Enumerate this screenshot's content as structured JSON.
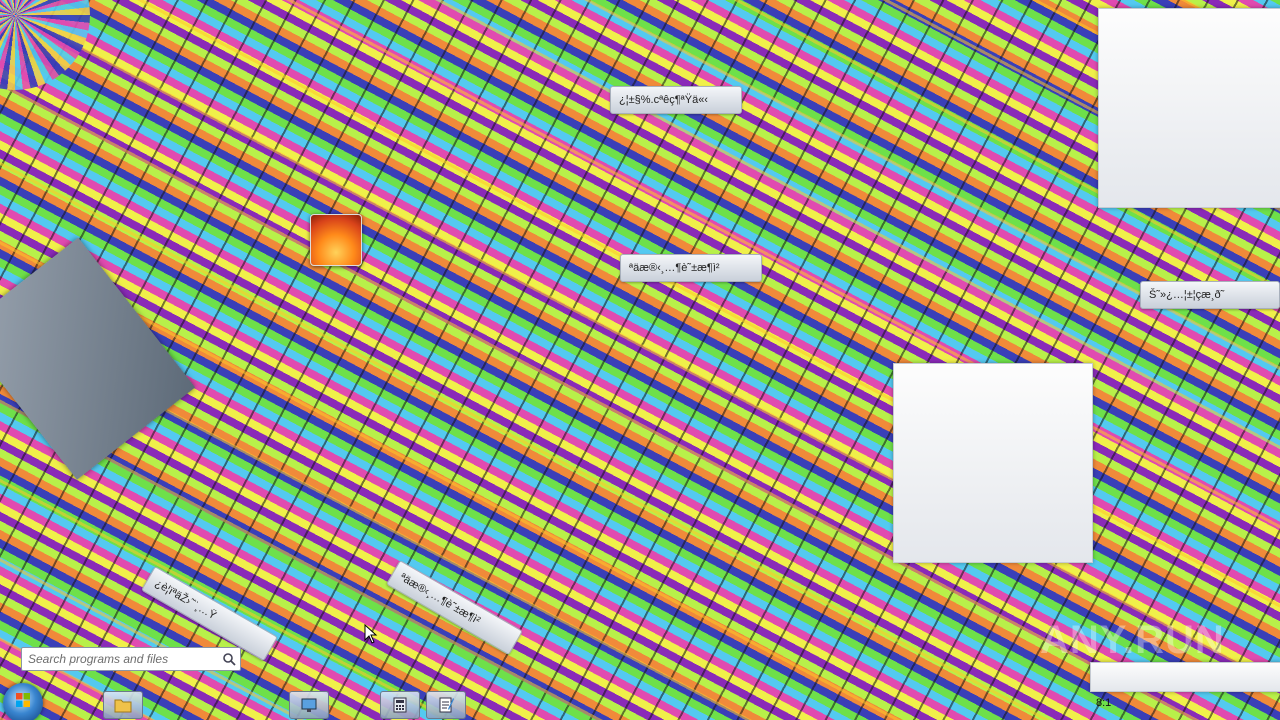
{
  "desktop": {
    "icon_names": {
      "desktop_image_icon": "photo-icon",
      "start": "windows-start-icon",
      "explorer": "folder-icon",
      "network": "monitor-icon",
      "calculator": "calculator-icon",
      "notepad": "notepad-icon",
      "search": "search-icon"
    },
    "labels": {
      "tag_1": "¿¦±§%.cªêç¶ªŸä«‹",
      "tag_2": "ªäæ®‹¸…¶è˜±æ¶ì²",
      "tag_3": "Š˜»¿…¦±¦çæ¸ð˜",
      "tag_4": "ªäæ®‹¸…¶è˜±æ¶ì²",
      "tag_5": "¿è¦ïªäŽ›˜¨¸…Ÿ"
    },
    "watermark": "ANY.RUN"
  },
  "start_menu": {
    "search_placeholder": "Search programs and files"
  },
  "tray": {
    "clock_text": "8:1"
  },
  "colors": {
    "accent": "#3a86d0",
    "panel": "#f4f6f9"
  }
}
